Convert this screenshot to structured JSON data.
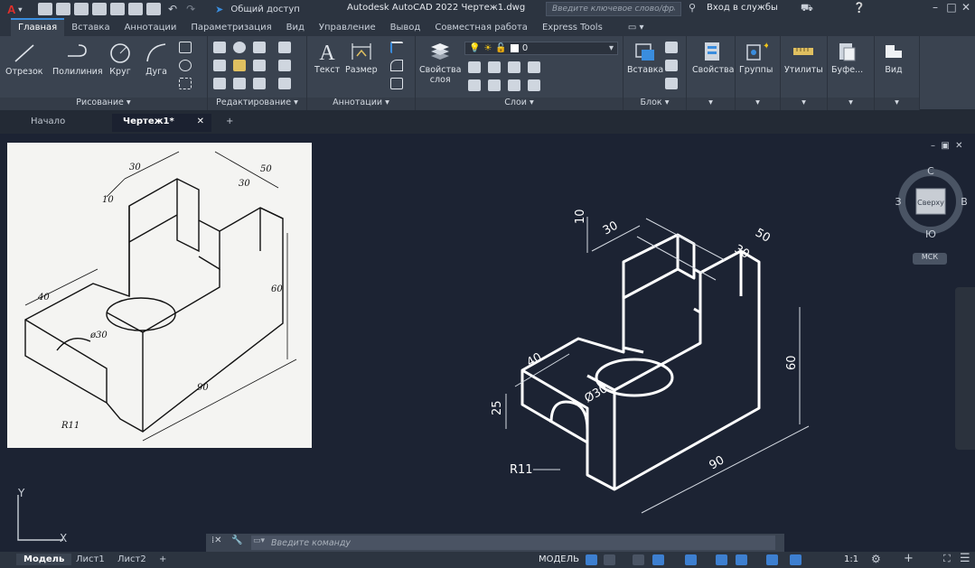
{
  "app": {
    "logo": "A",
    "share_label": "Общий доступ",
    "title": "Autodesk AutoCAD 2022   Чертеж1.dwg",
    "search_placeholder": "Введите ключевое слово/фразу",
    "signin_label": "Вход в службы"
  },
  "ribbon_tabs": [
    "Главная",
    "Вставка",
    "Аннотации",
    "Параметризация",
    "Вид",
    "Управление",
    "Вывод",
    "Совместная работа",
    "Express Tools"
  ],
  "ribbon": {
    "draw": {
      "title": "Рисование",
      "tools": [
        "Отрезок",
        "Полилиния",
        "Круг",
        "Дуга"
      ]
    },
    "modify": {
      "title": "Редактирование"
    },
    "annotation": {
      "title": "Аннотации",
      "tools": [
        "Текст",
        "Размер"
      ]
    },
    "layers": {
      "title": "Слои",
      "props_label_1": "Свойства",
      "props_label_2": "слоя",
      "layer_value": "0"
    },
    "block": {
      "title": "Блок",
      "tool": "Вставка"
    },
    "groups": [
      "Свойства",
      "Группы",
      "Утилиты",
      "Буфе...",
      "Вид"
    ]
  },
  "doc_tabs": {
    "start": "Начало",
    "active": "Чертеж1*"
  },
  "viewcube": {
    "north": "С",
    "south": "Ю",
    "west": "З",
    "east": "В",
    "face": "Сверху",
    "ucs": "МСК"
  },
  "command": {
    "placeholder": "Введите команду"
  },
  "layout_tabs": [
    "Модель",
    "Лист1",
    "Лист2"
  ],
  "status": {
    "mode": "МОДЕЛЬ",
    "scale": "1:1"
  },
  "ucs_axes": {
    "x": "X",
    "y": "Y"
  },
  "drawing": {
    "dims": {
      "d10": "10",
      "d30a": "30",
      "d50": "50",
      "d30b": "30",
      "d60": "60",
      "d40": "40",
      "d25": "25",
      "dia": "Ø30",
      "d90": "90",
      "r11": "R11"
    }
  },
  "reference": {
    "dims": {
      "d30": "30",
      "d10": "10",
      "d50": "50",
      "d30b": "30",
      "d60": "60",
      "d40": "40",
      "dia": "ø30",
      "d90": "90",
      "r11": "R11"
    }
  },
  "colors": {
    "accent": "#3a8dde",
    "canvas": "#1c2333",
    "logo": "#e0302c"
  }
}
